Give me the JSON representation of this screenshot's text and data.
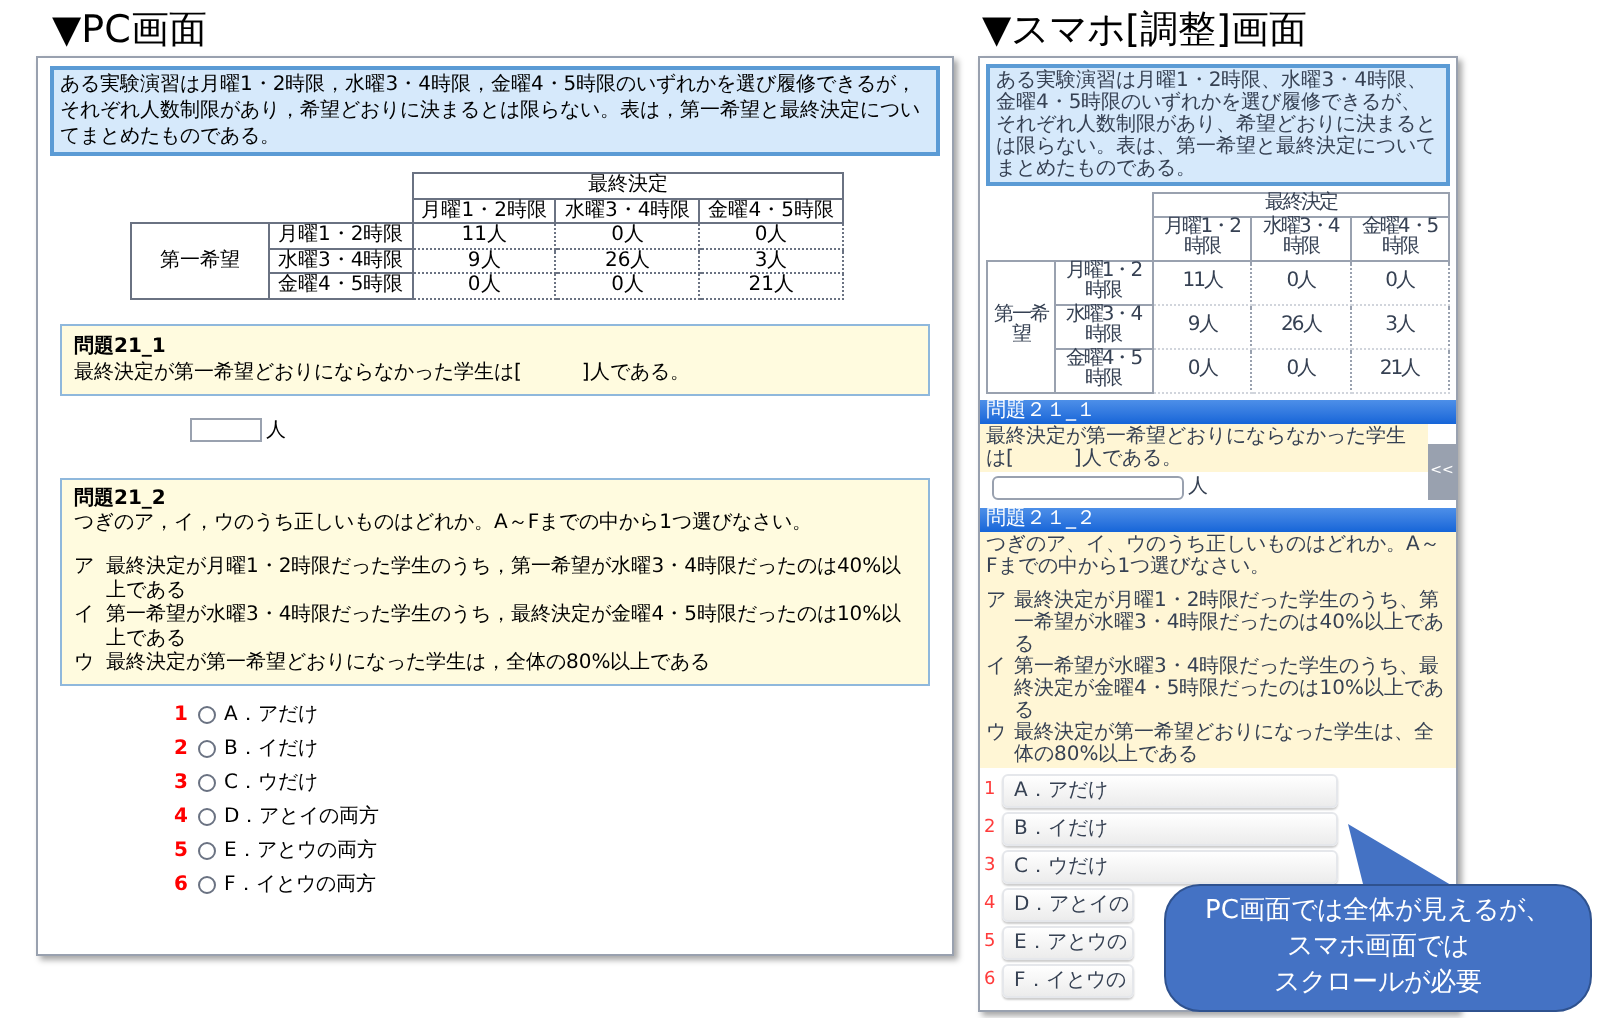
{
  "pc": {
    "heading": "▼PC画面",
    "intro": "ある実験演習は月曜1・2時限，水曜3・4時限，金曜4・5時限のいずれかを選び履修できるが，それぞれ人数制限があり，希望どおりに決まるとは限らない。表は，第一希望と最終決定についてまとめたものである。",
    "table": {
      "group_header": "最終決定",
      "columns": [
        "月曜1・2時限",
        "水曜3・4時限",
        "金曜4・5時限"
      ],
      "row_group": "第一希望",
      "rows": [
        {
          "label": "月曜1・2時限",
          "cells": [
            "11人",
            "0人",
            "0人"
          ]
        },
        {
          "label": "水曜3・4時限",
          "cells": [
            "9人",
            "26人",
            "3人"
          ]
        },
        {
          "label": "金曜4・5時限",
          "cells": [
            "0人",
            "0人",
            "21人"
          ]
        }
      ]
    },
    "question1": {
      "title": "問題21_1",
      "text": "最終決定が第一希望どおりにならなかった学生は[　　　]人である。"
    },
    "answer_unit": "人",
    "question2": {
      "title": "問題21_2",
      "text": "つぎのア，イ，ウのうち正しいものはどれか。A～Fまでの中から1つ選びなさい。",
      "items": [
        {
          "marker": "ア",
          "text": "最終決定が月曜1・2時限だった学生のうち，第一希望が水曜3・4時限だったのは40%以上である"
        },
        {
          "marker": "イ",
          "text": "第一希望が水曜3・4時限だった学生のうち，最終決定が金曜4・5時限だったのは10%以上である"
        },
        {
          "marker": "ウ",
          "text": "最終決定が第一希望どおりになった学生は，全体の80%以上である"
        }
      ]
    },
    "options": [
      {
        "number": "1",
        "label": "A．アだけ",
        "selected": false
      },
      {
        "number": "2",
        "label": "B．イだけ",
        "selected": false
      },
      {
        "number": "3",
        "label": "C．ウだけ",
        "selected": false
      },
      {
        "number": "4",
        "label": "D．アとイの両方",
        "selected": false
      },
      {
        "number": "5",
        "label": "E．アとウの両方",
        "selected": false
      },
      {
        "number": "6",
        "label": "F．イとウの両方",
        "selected": false
      }
    ]
  },
  "mobile": {
    "heading": "▼スマホ[調整]画面",
    "intro": "ある実験演習は月曜1・2時限、水曜3・4時限、金曜4・5時限のいずれかを選び履修できるが、それぞれ人数制限があり、希望どおりに決まるとは限らない。表は、第一希望と最終決定についてまとめたものである。",
    "table": {
      "group_header": "最終決定",
      "columns": [
        "月曜1・2時限",
        "水曜3・4時限",
        "金曜4・5時限"
      ],
      "row_group": "第一希望",
      "rows": [
        {
          "label": "月曜1・2時限",
          "cells": [
            "11人",
            "0人",
            "0人"
          ]
        },
        {
          "label": "水曜3・4時限",
          "cells": [
            "9人",
            "26人",
            "3人"
          ]
        },
        {
          "label": "金曜4・5時限",
          "cells": [
            "0人",
            "0人",
            "21人"
          ]
        }
      ]
    },
    "question1": {
      "title": "問題２１_１",
      "text": "最終決定が第一希望どおりにならなかった学生は[　　　]人である。"
    },
    "answer_unit": "人",
    "side_tab": "<<",
    "question2": {
      "title": "問題２１_２",
      "text": "つぎのア、イ、ウのうち正しいものはどれか。A～Fまでの中から1つ選びなさい。",
      "items": [
        {
          "marker": "ア",
          "text": "最終決定が月曜1・2時限だった学生のうち、第一希望が水曜3・4時限だったのは40%以上である"
        },
        {
          "marker": "イ",
          "text": "第一希望が水曜3・4時限だった学生のうち、最終決定が金曜4・5時限だったのは10%以上である"
        },
        {
          "marker": "ウ",
          "text": "最終決定が第一希望どおりになった学生は、全体の80%以上である"
        }
      ]
    },
    "options": [
      {
        "number": "1",
        "label": "A．アだけ",
        "selected": false
      },
      {
        "number": "2",
        "label": "B．イだけ",
        "selected": false
      },
      {
        "number": "3",
        "label": "C．ウだけ",
        "selected": false
      },
      {
        "number": "4",
        "label": "D．アとイの",
        "selected": false
      },
      {
        "number": "5",
        "label": "E．アとウの",
        "selected": false
      },
      {
        "number": "6",
        "label": "F．イとウの",
        "selected": false
      }
    ]
  },
  "callout": {
    "lines": [
      "PC画面では全体が見えるが、",
      "スマホ画面では",
      "スクロールが必要"
    ]
  }
}
